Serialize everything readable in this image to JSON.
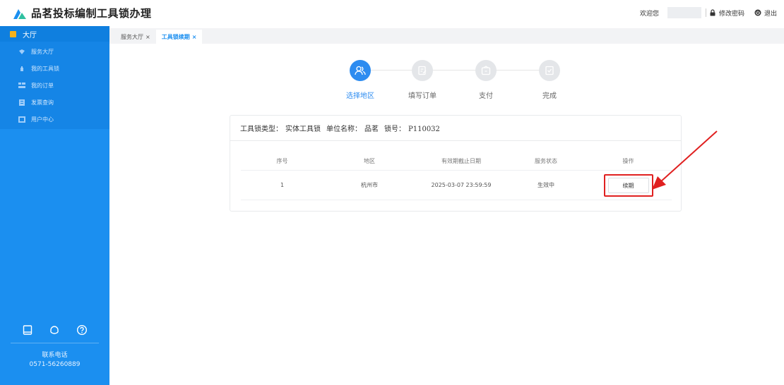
{
  "header": {
    "app_title": "品茗投标编制工具锁办理",
    "welcome": "欢迎您",
    "change_password": "修改密码",
    "logout": "退出"
  },
  "sidebar": {
    "section_label": "大厅",
    "items": [
      {
        "label": "服务大厅",
        "icon": "service-hall-icon"
      },
      {
        "label": "我的工具锁",
        "icon": "lock-icon"
      },
      {
        "label": "我的订单",
        "icon": "order-icon"
      },
      {
        "label": "发票查询",
        "icon": "invoice-icon"
      },
      {
        "label": "用户中心",
        "icon": "user-center-icon"
      }
    ],
    "footer_icons": [
      "book-icon",
      "headset-icon",
      "help-icon"
    ],
    "contact_label": "联系电话",
    "contact_phone": "0571-56260889"
  },
  "tabs": [
    {
      "label": "服务大厅",
      "active": false
    },
    {
      "label": "工具锁续期",
      "active": true
    }
  ],
  "steps": [
    {
      "label": "选择地区",
      "active": true
    },
    {
      "label": "填写订单",
      "active": false
    },
    {
      "label": "支付",
      "active": false
    },
    {
      "label": "完成",
      "active": false
    }
  ],
  "card": {
    "lock_type_label": "工具锁类型：",
    "lock_type_value": "实体工具锁",
    "unit_label": "单位名称：",
    "unit_value": "品茗",
    "lock_no_label": "锁号：",
    "lock_no_value": "P110032"
  },
  "table": {
    "headers": [
      "序号",
      "地区",
      "有效期截止日期",
      "服务状态",
      "操作"
    ],
    "rows": [
      {
        "index": "1",
        "region": "杭州市",
        "expiry": "2025-03-07 23:59:59",
        "status": "生效中",
        "action": "续期"
      }
    ]
  },
  "colors": {
    "primary": "#2d8cf0",
    "sidebar": "#1b8ff0",
    "highlight": "#e02020"
  }
}
